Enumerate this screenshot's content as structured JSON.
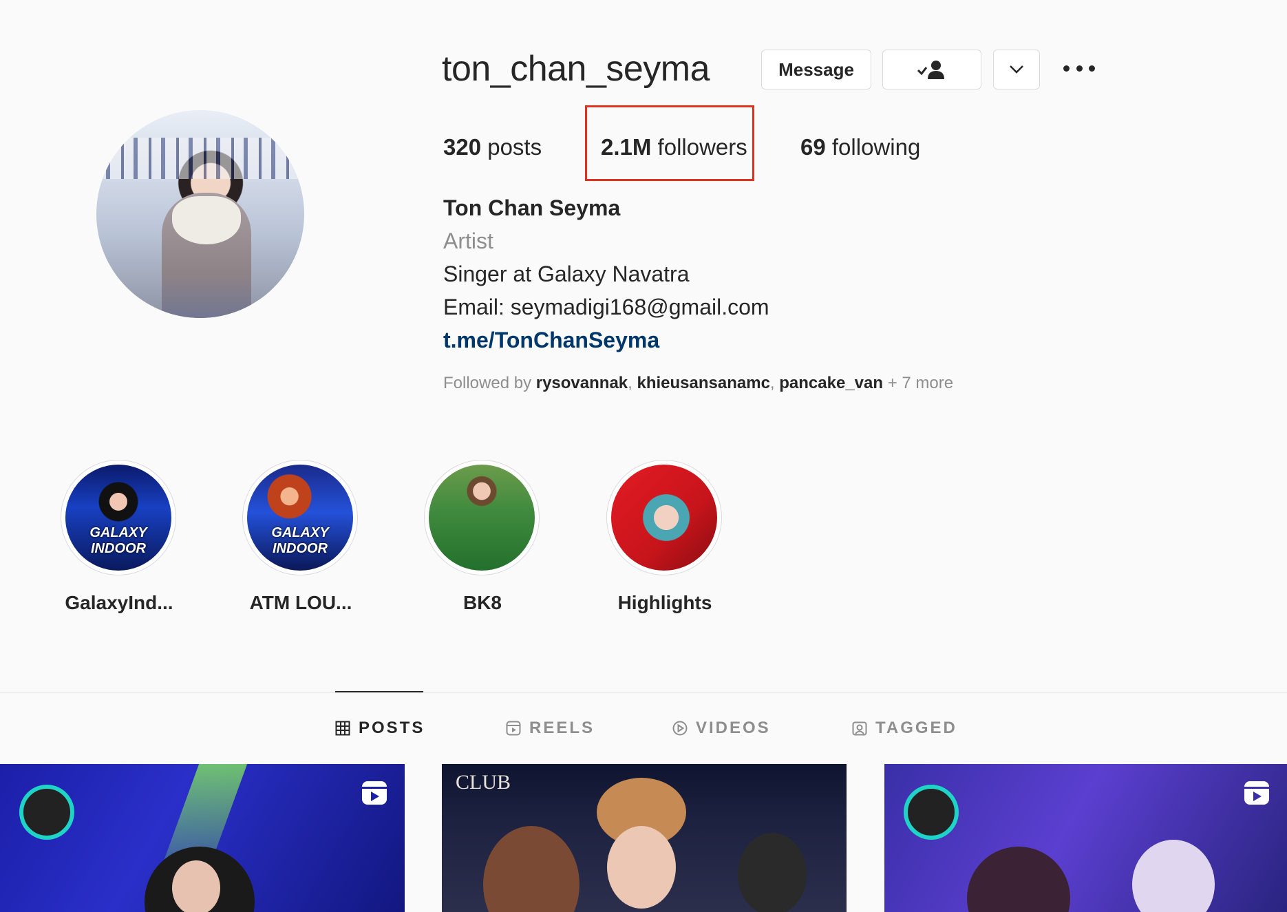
{
  "profile": {
    "username": "ton_chan_seyma",
    "message_label": "Message",
    "stats": {
      "posts_count": "320",
      "posts_label": " posts",
      "followers_count": "2.1M",
      "followers_label": " followers",
      "following_count": "69",
      "following_label": " following"
    },
    "bio": {
      "name": "Ton Chan Seyma",
      "category": "Artist",
      "line1": "Singer at Galaxy Navatra",
      "line2": "Email: seymadigi168@gmail.com",
      "link": "t.me/TonChanSeyma"
    },
    "followed_by": {
      "prefix": "Followed by ",
      "users": [
        "rysovannak",
        "khieusansanamc",
        "pancake_van"
      ],
      "separator": ", ",
      "suffix": " + 7 more"
    }
  },
  "highlights": [
    {
      "label": "GalaxyInd...",
      "image_text": "GALAXY INDOOR"
    },
    {
      "label": "ATM LOU...",
      "image_text": "GALAXY INDOOR"
    },
    {
      "label": "BK8",
      "image_text": ""
    },
    {
      "label": "Highlights",
      "image_text": ""
    }
  ],
  "tabs": [
    {
      "label": "POSTS",
      "icon": "grid-icon",
      "active": true
    },
    {
      "label": "REELS",
      "icon": "reels-icon",
      "active": false
    },
    {
      "label": "VIDEOS",
      "icon": "play-icon",
      "active": false
    },
    {
      "label": "TAGGED",
      "icon": "tagged-icon",
      "active": false
    }
  ],
  "posts": [
    {
      "overlay_text": "",
      "type": "reel"
    },
    {
      "overlay_text": "CLUB",
      "type": "photo"
    },
    {
      "overlay_text": "",
      "type": "reel"
    }
  ],
  "colors": {
    "highlight_box": "#e0301e",
    "link": "#00376b",
    "muted": "#8e8e8e"
  }
}
